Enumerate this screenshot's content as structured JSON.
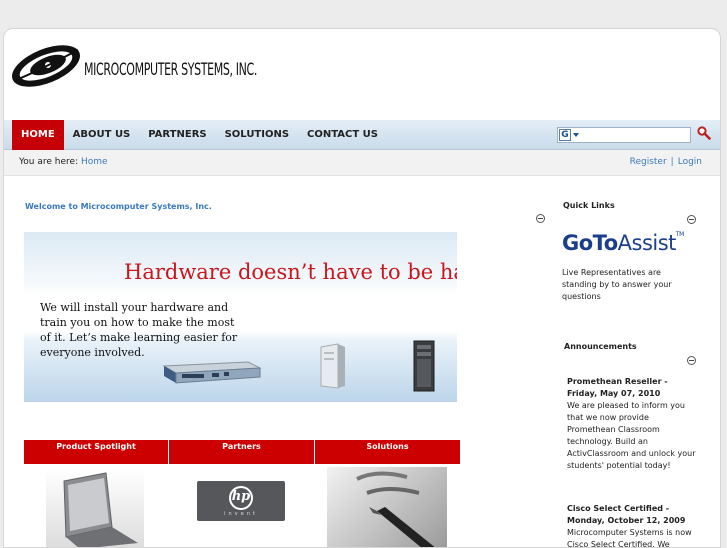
{
  "brand": {
    "company_name": "MICROCOMPUTER SYSTEMS, INC."
  },
  "nav": {
    "items": [
      {
        "label": "HOME",
        "active": true
      },
      {
        "label": "ABOUT US",
        "active": false
      },
      {
        "label": "PARTNERS",
        "active": false
      },
      {
        "label": "SOLUTIONS",
        "active": false
      },
      {
        "label": "CONTACT US",
        "active": false
      }
    ],
    "accent": "#c50006"
  },
  "search": {
    "engine_glyph": "G",
    "value": ""
  },
  "breadcrumb": {
    "label": "You are here:",
    "home": "Home"
  },
  "account": {
    "register": "Register",
    "separator": "|",
    "login": "Login"
  },
  "main": {
    "welcome": "Welcome to Microcomputer Systems, Inc.",
    "banner": {
      "headline": "Hardware doesn’t have to be hard",
      "text": "We will install your hardware and train you on how to make the most of it. Let’s make learning easier for everyone involved."
    },
    "features": [
      {
        "title": "Product Spotlight"
      },
      {
        "title": "Partners"
      },
      {
        "title": "Solutions"
      }
    ],
    "partner_logo_text": "invent"
  },
  "sidebar": {
    "quick_links": {
      "title": "Quick Links",
      "goto_bold": "GoTo",
      "goto_thin": "Assist",
      "goto_tm": "TM",
      "text": "Live Representatives are standing by to answer your questions"
    },
    "announcements": {
      "title": "Announcements",
      "items": [
        {
          "title": "Promethean Reseller - Friday, May 07, 2010",
          "body": "We are pleased to inform you that we now provide Promethean Classroom technology. Build an ActivClassroom and unlock your students' potential today!"
        },
        {
          "title": "Cisco Select Certified - Monday, October 12, 2009",
          "body": "Microcomputer Systems is now Cisco Select Certified. We"
        }
      ]
    }
  },
  "colors": {
    "link": "#3a7abf",
    "feature_header": "#cc0000",
    "headline": "#c8161c",
    "goto": "#1a3e8c"
  }
}
